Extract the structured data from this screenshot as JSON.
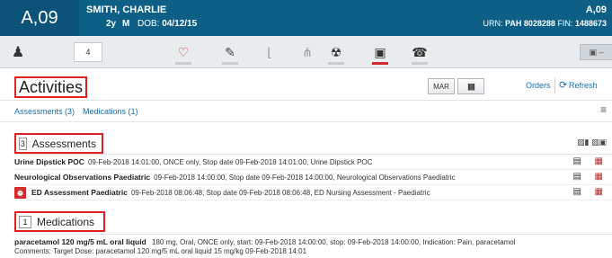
{
  "header": {
    "location": "A,09",
    "patient_name": "SMITH, CHARLIE",
    "age": "2y",
    "sex": "M",
    "dob_label": "DOB:",
    "dob_value": "04/12/15",
    "location_right": "A,09",
    "urn_label": "URN:",
    "urn_value": "PAH 8028288",
    "fin_label": "FIN:",
    "fin_value": "1488673"
  },
  "toolbar": {
    "tab_number": "4",
    "message_button": "▣ –",
    "icons": [
      "person-icon",
      "heart-icon",
      "pen-icon",
      "thermometer-icon",
      "ecg-icon",
      "radiation-icon",
      "medical-bag-icon",
      "phone-icon"
    ]
  },
  "page": {
    "title": "Activities",
    "mar_label": "MAR",
    "barcode_label": "||||||",
    "orders_label": "Orders",
    "refresh_label": "Refresh"
  },
  "filters": {
    "assessments": "Assessments (3)",
    "medications": "Medications (1)"
  },
  "assessments": {
    "count": "3",
    "label": "Assessments",
    "rows": [
      {
        "name": "Urine Dipstick POC",
        "detail": "09-Feb-2018 14:01:00, ONCE only, Stop date 09-Feb-2018 14:01:00, Urine Dipstick POC"
      },
      {
        "name": "Neurological Observations Paediatric",
        "detail": "09-Feb-2018 14:00:00, Stop date 09-Feb-2018 14:00:00, Neurological Observations Paediatric"
      },
      {
        "name": "ED Assessment Paediatric",
        "detail": "09-Feb-2018 08:06:48, Stop date 09-Feb-2018 08:06:48, ED Nursing Assessment - Paediatric"
      }
    ]
  },
  "medications": {
    "count": "1",
    "label": "Medications",
    "rows": [
      {
        "name": "paracetamol 120 mg/5 mL oral liquid",
        "detail": "180 mg, Oral, ONCE only, start: 09-Feb-2018 14:00:00, stop: 09-Feb-2018 14:00:00, Indication: Pain, paracetamol",
        "comment": "Comments: Target Dose: paracetamol 120 mg/5 mL oral liquid 15 mg/kg 09-Feb-2018 14:01"
      }
    ]
  },
  "colors": {
    "header_bg": "#0d5f86",
    "highlight_border": "#e02020",
    "link": "#1a6fb3",
    "alert": "#d62828"
  }
}
